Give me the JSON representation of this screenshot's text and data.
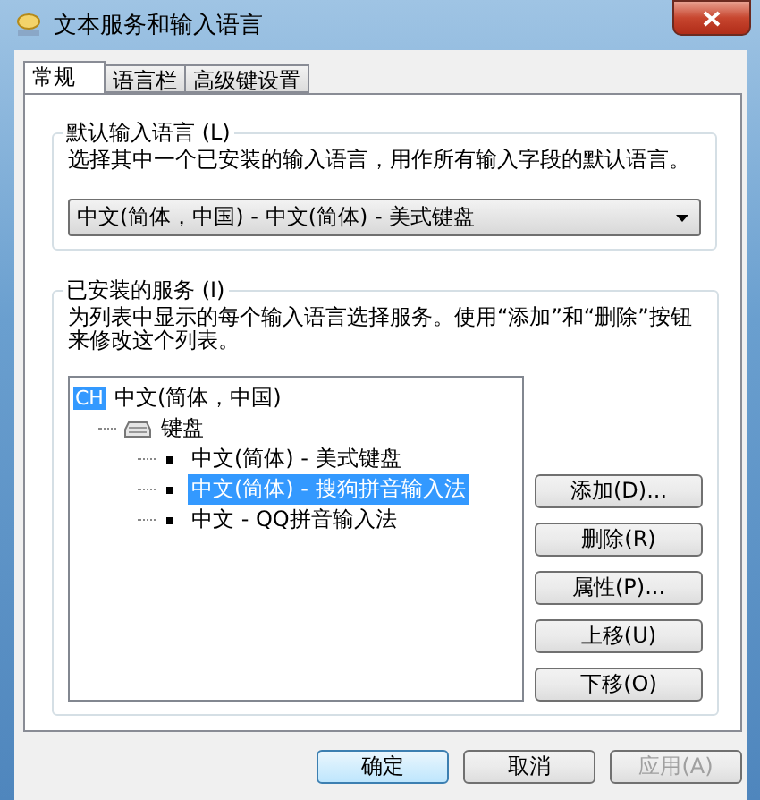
{
  "window": {
    "title": "文本服务和输入语言"
  },
  "tabs": [
    {
      "label": "常规",
      "selected": true
    },
    {
      "label": "语言栏",
      "selected": false
    },
    {
      "label": "高级键设置",
      "selected": false
    }
  ],
  "default_language": {
    "title": "默认输入语言 (L)",
    "description": "选择其中一个已安装的输入语言，用作所有输入字段的默认语言。",
    "dropdown": {
      "value": "中文(简体，中国) - 中文(简体) - 美式键盘"
    }
  },
  "installed_services": {
    "title": "已安装的服务 (I)",
    "description": "为列表中显示的每个输入语言选择服务。使用“添加”和“删除”按钮来修改这个列表。",
    "tree": [
      {
        "kind": "language",
        "badge": "CH",
        "label": "中文(简体，中国)",
        "selected": false,
        "children": [
          {
            "kind": "category",
            "label": "键盘",
            "selected": false,
            "children": [
              {
                "kind": "service",
                "label": "中文(简体) - 美式键盘",
                "selected": false
              },
              {
                "kind": "service",
                "label": "中文(简体) - 搜狗拼音输入法",
                "selected": true
              },
              {
                "kind": "service",
                "label": "中文 - QQ拼音输入法",
                "selected": false
              }
            ]
          }
        ]
      }
    ],
    "buttons": [
      {
        "label": "添加(D)..."
      },
      {
        "label": "删除(R)"
      },
      {
        "label": "属性(P)..."
      },
      {
        "label": "上移(U)"
      },
      {
        "label": "下移(O)"
      }
    ]
  },
  "dialog_buttons": [
    {
      "label": "确定",
      "default": true,
      "disabled": false
    },
    {
      "label": "取消",
      "default": false,
      "disabled": false
    },
    {
      "label": "应用(A)",
      "default": false,
      "disabled": true
    }
  ]
}
